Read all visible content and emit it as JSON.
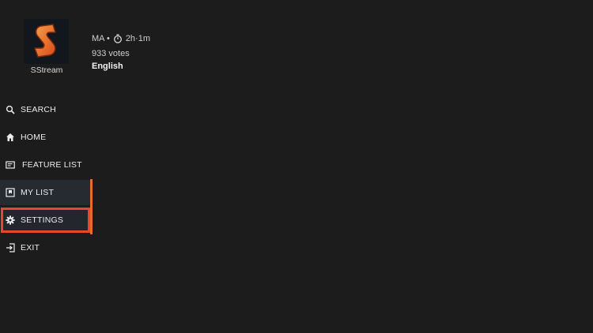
{
  "app": {
    "name": "SStream",
    "logo_icon": "sstream-logo-icon",
    "colors": {
      "background": "#1c1c1d",
      "logo_bg": "#12161d",
      "logo_orange": "#f07a2a",
      "accent": "#e86b2a",
      "highlight": "#e8472a"
    }
  },
  "meta": {
    "genre_fragment": "MA •",
    "timer_icon": "timer-icon",
    "duration": "2h·1m",
    "votes": "933 votes",
    "language": "English"
  },
  "menu": {
    "items": [
      {
        "id": "search",
        "label": "SEARCH",
        "icon": "search-icon"
      },
      {
        "id": "home",
        "label": "HOME",
        "icon": "home-icon"
      },
      {
        "id": "feature",
        "label": "FEATURE LIST",
        "icon": "feature-list-icon"
      },
      {
        "id": "mylist",
        "label": "MY LIST",
        "icon": "bookmark-list-icon"
      },
      {
        "id": "settings",
        "label": "SETTINGS",
        "icon": "gear-icon"
      },
      {
        "id": "exit",
        "label": "EXIT",
        "icon": "exit-icon"
      }
    ],
    "selected": "settings"
  }
}
